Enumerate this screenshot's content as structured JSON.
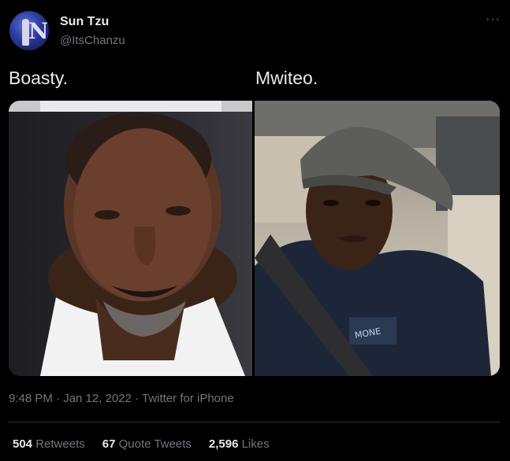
{
  "author": {
    "name": "Sun Tzu",
    "handle": "@ItsChanzu",
    "avatar_icon": "profile-avatar"
  },
  "tweet": {
    "captions": [
      "Boasty.",
      "Mwiteo."
    ],
    "timestamp": "9:48 PM · Jan 12, 2022 · Twitter for iPhone"
  },
  "stats": {
    "retweets": {
      "count": "504",
      "label": "Retweets"
    },
    "quote_tweets": {
      "count": "67",
      "label": "Quote Tweets"
    },
    "likes": {
      "count": "2,596",
      "label": "Likes"
    }
  },
  "menu": {
    "more_label": "···"
  },
  "colors": {
    "background": "#000000",
    "text": "#e7e9ea",
    "muted": "#71767b",
    "divider": "#2f3336"
  }
}
